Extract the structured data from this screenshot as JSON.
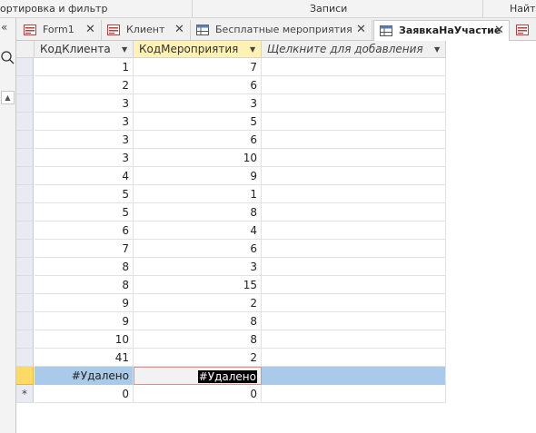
{
  "ribbon": {
    "groups": [
      "ортировка и фильтр",
      "Записи",
      "Найти"
    ]
  },
  "nav": {
    "collapse_icon": "chevrons-left-icon",
    "search_icon": "magnifier-icon",
    "scroll_icon": "scroll-up-icon"
  },
  "tabs": [
    {
      "label": "Form1",
      "icon": "form-icon",
      "active": false
    },
    {
      "label": "Клиент",
      "icon": "form-icon",
      "active": false
    },
    {
      "label": "Бесплатные мероприятия",
      "icon": "table-icon",
      "active": false
    },
    {
      "label": "ЗаявкаНаУчастие",
      "icon": "table-icon",
      "active": true
    },
    {
      "label": "",
      "icon": "form-icon",
      "active": false
    }
  ],
  "grid": {
    "columns": [
      "КодКлиента",
      "КодМероприятия",
      "Щелкните для добавления"
    ],
    "selected_column": "КодМероприятия",
    "rows": [
      [
        "1",
        "7"
      ],
      [
        "2",
        "6"
      ],
      [
        "3",
        "3"
      ],
      [
        "3",
        "5"
      ],
      [
        "3",
        "6"
      ],
      [
        "3",
        "10"
      ],
      [
        "4",
        "9"
      ],
      [
        "5",
        "1"
      ],
      [
        "5",
        "8"
      ],
      [
        "6",
        "4"
      ],
      [
        "7",
        "6"
      ],
      [
        "8",
        "3"
      ],
      [
        "8",
        "15"
      ],
      [
        "9",
        "2"
      ],
      [
        "9",
        "8"
      ],
      [
        "10",
        "8"
      ],
      [
        "41",
        "2"
      ]
    ],
    "current_row": [
      "#Удалено",
      "#Удалено"
    ],
    "new_row_marker": "*",
    "new_row": [
      "0",
      "0"
    ]
  },
  "colors": {
    "current_row": "#a9cbe9",
    "selected_header": "#fff2b3",
    "current_selector": "#ffd966"
  }
}
